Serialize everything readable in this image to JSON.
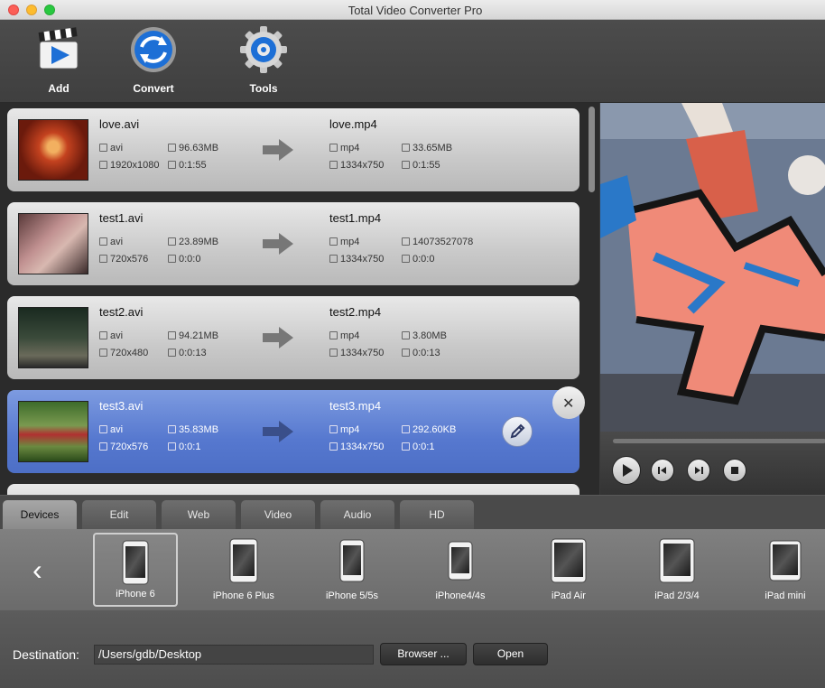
{
  "window": {
    "title": "Total Video Converter Pro"
  },
  "toolbar": {
    "add_label": "Add",
    "convert_label": "Convert",
    "tools_label": "Tools"
  },
  "files": [
    {
      "src_name": "love.avi",
      "src_format": "avi",
      "src_size": "96.63MB",
      "src_res": "1920x1080",
      "src_dur": "0:1:55",
      "dst_name": "love.mp4",
      "dst_format": "mp4",
      "dst_size": "33.65MB",
      "dst_res": "1334x750",
      "dst_dur": "0:1:55"
    },
    {
      "src_name": "test1.avi",
      "src_format": "avi",
      "src_size": "23.89MB",
      "src_res": "720x576",
      "src_dur": "0:0:0",
      "dst_name": "test1.mp4",
      "dst_format": "mp4",
      "dst_size": "14073527078",
      "dst_res": "1334x750",
      "dst_dur": "0:0:0"
    },
    {
      "src_name": "test2.avi",
      "src_format": "avi",
      "src_size": "94.21MB",
      "src_res": "720x480",
      "src_dur": "0:0:13",
      "dst_name": "test2.mp4",
      "dst_format": "mp4",
      "dst_size": "3.80MB",
      "dst_res": "1334x750",
      "dst_dur": "0:0:13"
    },
    {
      "src_name": "test3.avi",
      "src_format": "avi",
      "src_size": "35.83MB",
      "src_res": "720x576",
      "src_dur": "0:0:1",
      "dst_name": "test3.mp4",
      "dst_format": "mp4",
      "dst_size": "292.60KB",
      "dst_res": "1334x750",
      "dst_dur": "0:0:1"
    }
  ],
  "tabs": [
    {
      "label": "Devices"
    },
    {
      "label": "Edit"
    },
    {
      "label": "Web"
    },
    {
      "label": "Video"
    },
    {
      "label": "Audio"
    },
    {
      "label": "HD"
    }
  ],
  "devices": [
    {
      "label": "iPhone 6"
    },
    {
      "label": "iPhone 6 Plus"
    },
    {
      "label": "iPhone 5/5s"
    },
    {
      "label": "iPhone4/4s"
    },
    {
      "label": "iPad Air"
    },
    {
      "label": "iPad 2/3/4"
    },
    {
      "label": "iPad mini"
    }
  ],
  "destination": {
    "label": "Destination:",
    "path": "/Users/gdb/Desktop",
    "browse_label": "Browser ...",
    "open_label": "Open"
  },
  "colors": {
    "selected_card": "#5678cf",
    "accent_blue": "#1d6fd6"
  }
}
